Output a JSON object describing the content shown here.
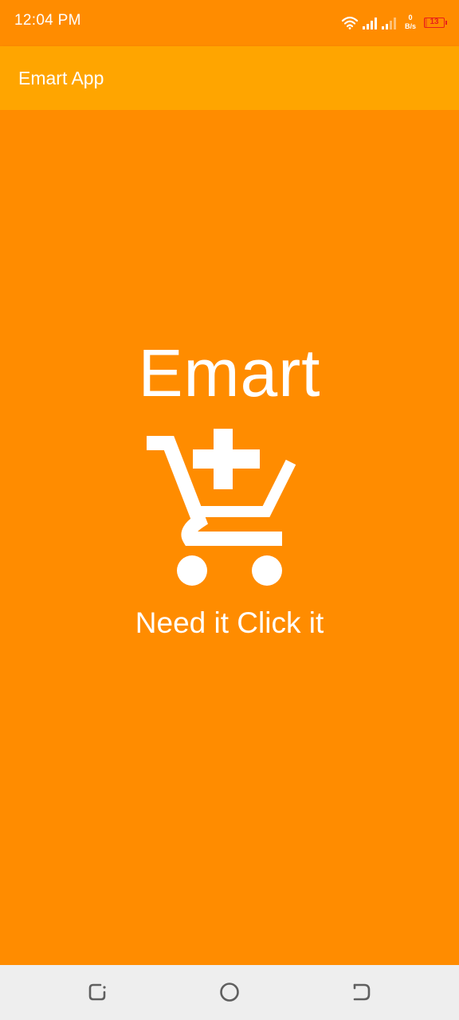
{
  "status_bar": {
    "time": "12:04 PM",
    "net_speed_value": "0",
    "net_speed_unit": "B/s",
    "battery_level": "13",
    "battery_fraction": 0.13,
    "icons": [
      "wifi-icon",
      "signal-icon",
      "signal-icon",
      "battery-icon"
    ]
  },
  "app_bar": {
    "title": "Emart App"
  },
  "splash": {
    "brand": "Emart",
    "logo_icon": "cart-plus-icon",
    "tagline": "Need it Click it"
  },
  "nav_bar": {
    "icons": [
      "recent-apps-icon",
      "home-icon",
      "back-icon"
    ]
  },
  "colors": {
    "background": "#FF8C00",
    "app_bar": "#FFA500",
    "foreground": "#FFFFFF",
    "battery_low": "#E8201A",
    "nav_bar": "#EEEEEE",
    "nav_icon": "#5F5F5F"
  }
}
